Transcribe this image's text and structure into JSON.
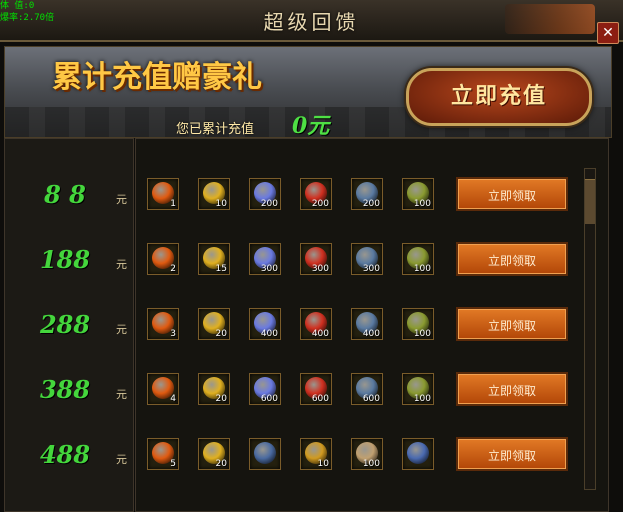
{
  "window": {
    "title": "超级回馈",
    "debug_line1": "体 值:0",
    "debug_line2": "爆率:2.70倍"
  },
  "banner": {
    "slogan": "累计充值赠豪礼",
    "total_label": "您已累计充值",
    "total_value": "0元",
    "recharge_button": "立即充值"
  },
  "unit_label": "元",
  "tiers": [
    {
      "amount": "8 8",
      "claim_label": "立即领取",
      "rewards": [
        {
          "icon": "flame-icon",
          "count": "1",
          "color": "#e05a10"
        },
        {
          "icon": "gold-ingot-icon",
          "count": "10",
          "color": "#e0b020"
        },
        {
          "icon": "blue-orb-icon",
          "count": "200",
          "color": "#6a7ae0"
        },
        {
          "icon": "red-orb-icon",
          "count": "200",
          "color": "#d03020"
        },
        {
          "icon": "dark-orb-icon",
          "count": "200",
          "color": "#5a7aa0"
        },
        {
          "icon": "feather-icon",
          "count": "100",
          "color": "#8a9a30"
        }
      ]
    },
    {
      "amount": "188",
      "claim_label": "立即领取",
      "rewards": [
        {
          "icon": "flame-icon",
          "count": "2",
          "color": "#e05a10"
        },
        {
          "icon": "gold-ingot-icon",
          "count": "15",
          "color": "#e0b020"
        },
        {
          "icon": "blue-orb-icon",
          "count": "300",
          "color": "#6a7ae0"
        },
        {
          "icon": "red-orb-icon",
          "count": "300",
          "color": "#d03020"
        },
        {
          "icon": "dark-orb-icon",
          "count": "300",
          "color": "#5a7aa0"
        },
        {
          "icon": "feather-icon",
          "count": "100",
          "color": "#8a9a30"
        }
      ]
    },
    {
      "amount": "288",
      "claim_label": "立即领取",
      "rewards": [
        {
          "icon": "flame-icon",
          "count": "3",
          "color": "#e05a10"
        },
        {
          "icon": "gold-ingot-icon",
          "count": "20",
          "color": "#e0b020"
        },
        {
          "icon": "blue-orb-icon",
          "count": "400",
          "color": "#6a7ae0"
        },
        {
          "icon": "red-orb-icon",
          "count": "400",
          "color": "#d03020"
        },
        {
          "icon": "dark-orb-icon",
          "count": "400",
          "color": "#5a7aa0"
        },
        {
          "icon": "feather-icon",
          "count": "100",
          "color": "#8a9a30"
        }
      ]
    },
    {
      "amount": "388",
      "claim_label": "立即领取",
      "rewards": [
        {
          "icon": "flame-icon",
          "count": "4",
          "color": "#e05a10"
        },
        {
          "icon": "gold-ingot-icon",
          "count": "20",
          "color": "#e0b020"
        },
        {
          "icon": "blue-orb-icon",
          "count": "600",
          "color": "#6a7ae0"
        },
        {
          "icon": "red-orb-icon",
          "count": "600",
          "color": "#d03020"
        },
        {
          "icon": "dark-orb-icon",
          "count": "600",
          "color": "#5a7aa0"
        },
        {
          "icon": "feather-icon",
          "count": "100",
          "color": "#8a9a30"
        }
      ]
    },
    {
      "amount": "488",
      "claim_label": "立即领取",
      "rewards": [
        {
          "icon": "flame-icon",
          "count": "5",
          "color": "#e05a10"
        },
        {
          "icon": "gold-ingot-icon",
          "count": "20",
          "color": "#e0b020"
        },
        {
          "icon": "axe-icon",
          "count": "",
          "color": "#4a6aa0"
        },
        {
          "icon": "gold-bar-icon",
          "count": "10",
          "color": "#d09a20"
        },
        {
          "icon": "scroll-icon",
          "count": "100",
          "color": "#c0a070"
        },
        {
          "icon": "book-icon",
          "count": "",
          "color": "#4a6ab0"
        }
      ]
    }
  ]
}
